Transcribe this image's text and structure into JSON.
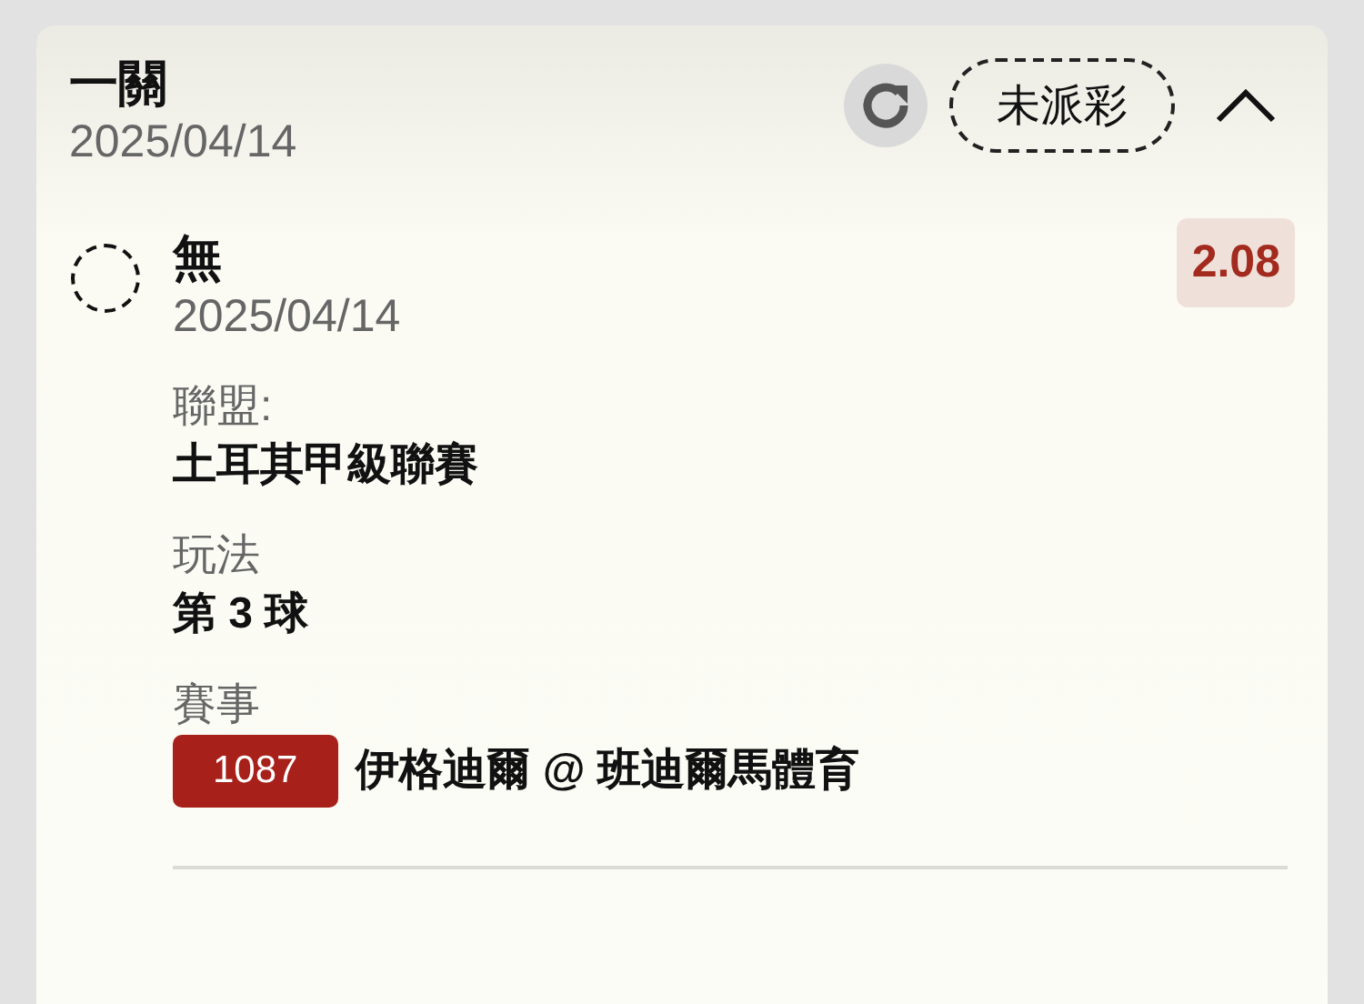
{
  "bet": {
    "title": "一關",
    "date": "2025/04/14",
    "status": "未派彩",
    "expanded": true
  },
  "selection": {
    "name": "無",
    "date": "2025/04/14",
    "odds": "2.08",
    "checked": false,
    "fields": [
      {
        "kind": "text",
        "label": "聯盟:",
        "value": "土耳其甲級聯賽"
      },
      {
        "kind": "text",
        "label": "玩法",
        "value": "第 3 球"
      },
      {
        "kind": "match",
        "label": "賽事",
        "code": "1087",
        "value": "伊格迪爾 @ 班迪爾馬體育"
      }
    ]
  }
}
